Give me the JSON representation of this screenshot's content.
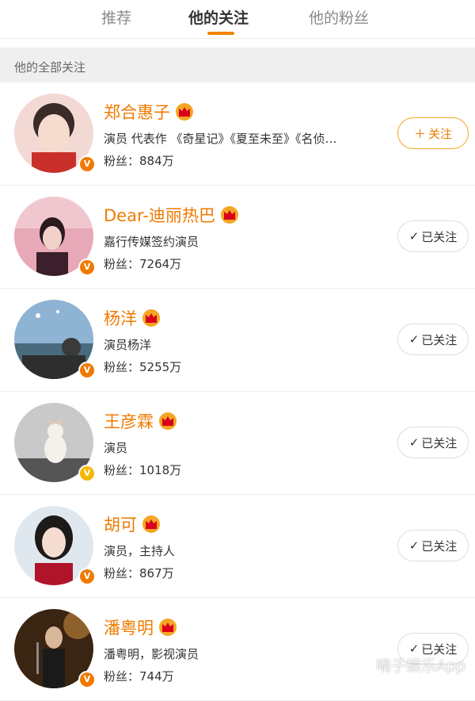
{
  "tabs": [
    {
      "label": "推荐",
      "active": false
    },
    {
      "label": "他的关注",
      "active": true
    },
    {
      "label": "他的粉丝",
      "active": false
    }
  ],
  "section_title": "他的全部关注",
  "accent_color": "#f07a00",
  "users": [
    {
      "name": "郑合惠子",
      "desc": "演员 代表作 《奇星记》《夏至未至》《名侦…",
      "fans": "粉丝：884万",
      "button": "关注",
      "button_icon": "plus-icon",
      "followed": false,
      "verified_color": "#f07a00"
    },
    {
      "name": "Dear-迪丽热巴",
      "desc": "嘉行传媒签约演员",
      "fans": "粉丝：7264万",
      "button": "已关注",
      "button_icon": "check-icon",
      "followed": true,
      "verified_color": "#f07a00"
    },
    {
      "name": "杨洋",
      "desc": "演员杨洋",
      "fans": "粉丝：5255万",
      "button": "已关注",
      "button_icon": "check-icon",
      "followed": true,
      "verified_color": "#f07a00"
    },
    {
      "name": "王彦霖",
      "desc": "演员",
      "fans": "粉丝：1018万",
      "button": "已关注",
      "button_icon": "check-icon",
      "followed": true,
      "verified_color": "#f5b800"
    },
    {
      "name": "胡可",
      "desc": "演员，主持人",
      "fans": "粉丝：867万",
      "button": "已关注",
      "button_icon": "check-icon",
      "followed": true,
      "verified_color": "#f07a00"
    },
    {
      "name": "潘粤明",
      "desc": "潘粤明，影视演员",
      "fans": "粉丝：744万",
      "button": "已关注",
      "button_icon": "check-icon",
      "followed": true,
      "verified_color": "#f07a00"
    }
  ],
  "watermark": "嘀子娱乐App"
}
